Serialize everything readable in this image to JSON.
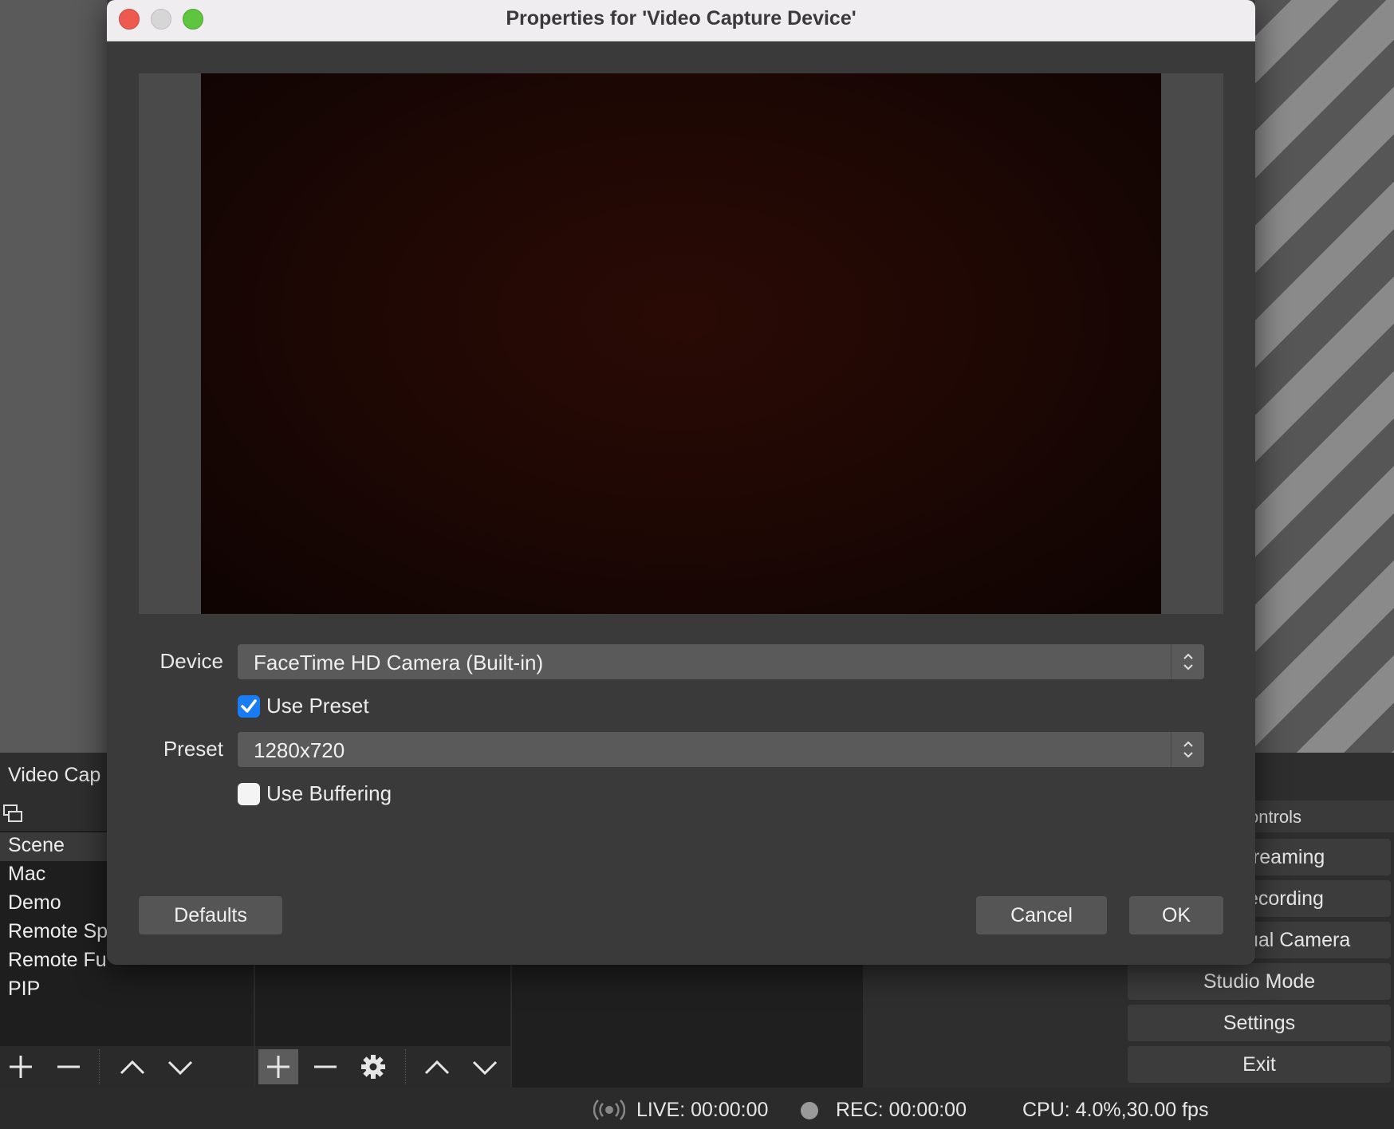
{
  "dialog": {
    "title": "Properties for 'Video Capture Device'",
    "device_label": "Device",
    "device_value": "FaceTime HD Camera (Built-in)",
    "use_preset_label": "Use Preset",
    "use_preset_checked": true,
    "preset_label": "Preset",
    "preset_value": "1280x720",
    "use_buffering_label": "Use Buffering",
    "use_buffering_checked": false,
    "defaults_button": "Defaults",
    "cancel_button": "Cancel",
    "ok_button": "OK"
  },
  "main": {
    "source_title": "Video Cap",
    "scenes": [
      "Scene",
      "Mac",
      "Demo",
      "Remote Sp",
      "Remote Fu",
      "PIP"
    ],
    "controls": {
      "header": "ontrols",
      "buttons": [
        "treaming",
        "ecording",
        "ual Camera",
        "Studio Mode",
        "Settings",
        "Exit"
      ]
    }
  },
  "status": {
    "live": "LIVE: 00:00:00",
    "rec": "REC: 00:00:00",
    "cpu": "CPU: 4.0%,30.00 fps"
  },
  "colors": {
    "accent": "#1a7cf5",
    "close": "#ee5a52",
    "minimize": "#d6d6d6",
    "zoom": "#5fc53f"
  }
}
